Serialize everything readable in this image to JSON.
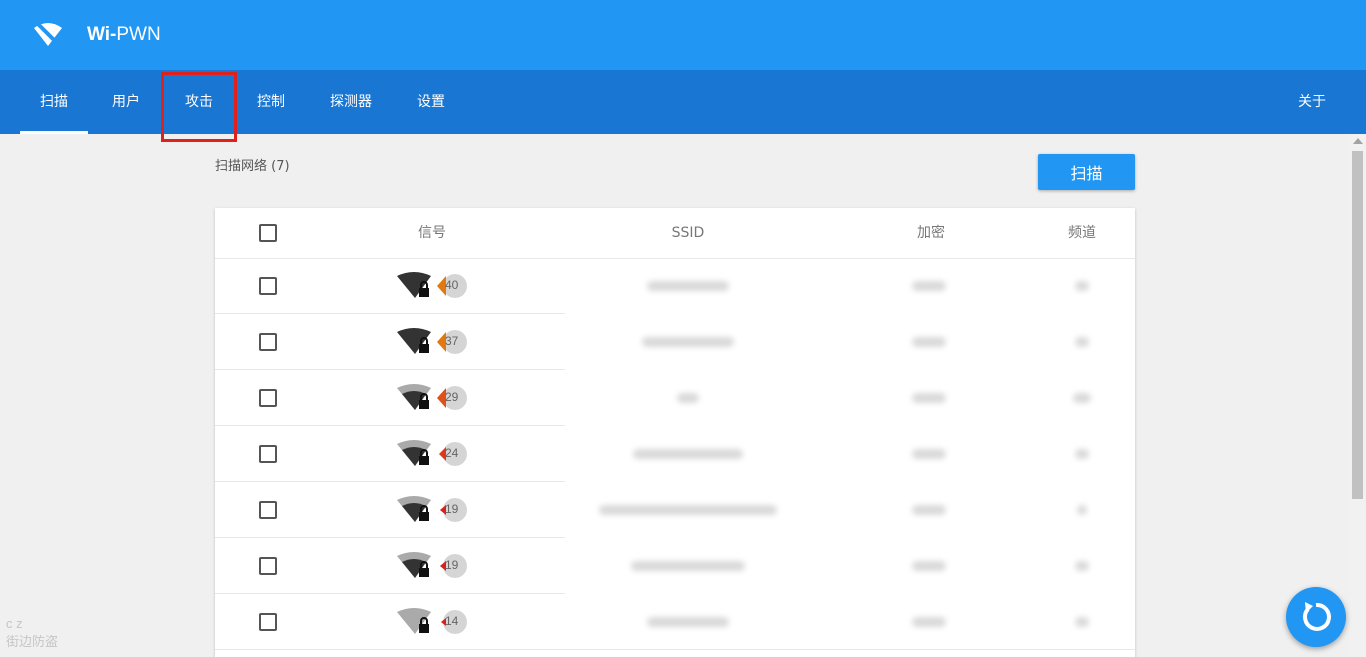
{
  "app": {
    "brand_prefix": "Wi-",
    "brand_suffix": "PWN"
  },
  "nav": {
    "tabs": [
      {
        "label": "扫描",
        "active": true
      },
      {
        "label": "用户"
      },
      {
        "label": "攻击"
      },
      {
        "label": "控制"
      },
      {
        "label": "探测器"
      },
      {
        "label": "设置"
      }
    ],
    "about_label": "关于"
  },
  "scan": {
    "title": "扫描网络 (7)",
    "button_label": "扫描"
  },
  "table": {
    "columns": [
      "信号",
      "SSID",
      "加密",
      "频道"
    ],
    "rows": [
      {
        "signal": "40",
        "color": "#e07a10"
      },
      {
        "signal": "37",
        "color": "#e07a10"
      },
      {
        "signal": "29",
        "color": "#e0501a"
      },
      {
        "signal": "24",
        "color": "#d83a1a"
      },
      {
        "signal": "19",
        "color": "#d82020"
      },
      {
        "signal": "19",
        "color": "#d82020"
      },
      {
        "signal": "14",
        "color": "#d82020"
      }
    ]
  },
  "watermark": {
    "top": "c  z",
    "bottom": "街边防盗"
  },
  "colors": {
    "appbar": "#2196f3",
    "navbar": "#1976d2",
    "highlight": "#e0201a"
  }
}
